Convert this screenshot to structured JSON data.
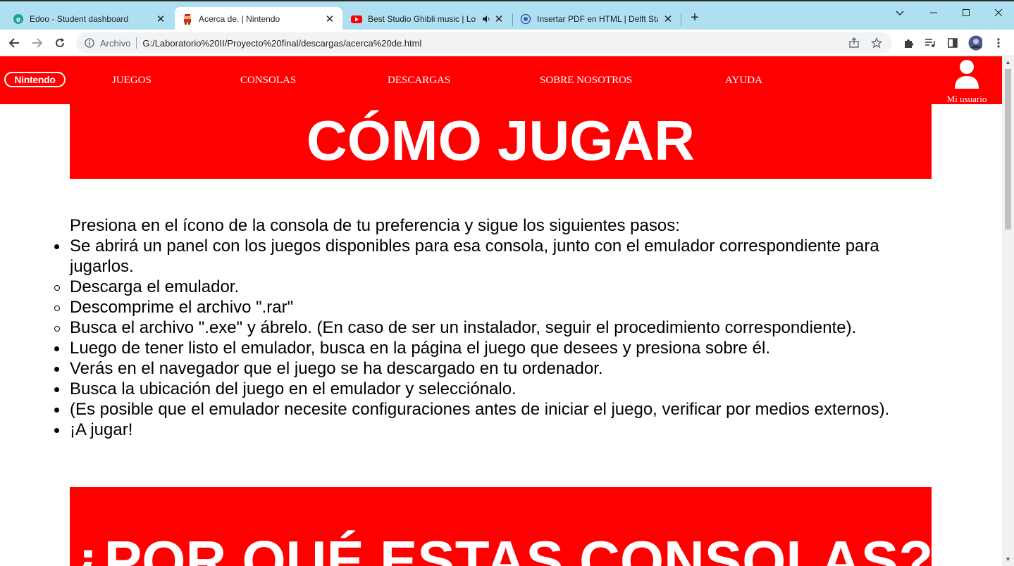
{
  "browser": {
    "tabs": [
      {
        "title": "Edoo - Student dashboard",
        "icon": "edoo-icon",
        "active": false
      },
      {
        "title": "Acerca de. | Nintendo",
        "icon": "mario-icon",
        "active": true
      },
      {
        "title": "Best Studio Ghibli music | Lo",
        "icon": "youtube-icon",
        "active": false
      },
      {
        "title": "Insertar PDF en HTML | Delft Stac",
        "icon": "delft-icon",
        "active": false
      }
    ],
    "address": {
      "label": "Archivo",
      "url": "G:/Laboratorio%20II/Proyecto%20final/descargas/acerca%20de.html"
    }
  },
  "site": {
    "logo": "Nintendo",
    "nav": [
      "JUEGOS",
      "CONSOLAS",
      "DESCARGAS",
      "SOBRE NOSOTROS",
      "AYUDA"
    ],
    "user_label": "Mi usuario",
    "brand_color": "#ff0000"
  },
  "main": {
    "banner_title": "CÓMO JUGAR",
    "intro": "Presiona en el ícono de la consola de tu preferencia y sigue los siguientes pasos:",
    "steps": [
      {
        "text": "Se abrirá un panel con los juegos disponibles para esa consola, junto con el emulador correspondiente para jugarlos.",
        "bullet": "disc"
      },
      {
        "text": "Descarga el emulador.",
        "bullet": "circle"
      },
      {
        "text": "Descomprime el archivo \".rar\"",
        "bullet": "circle"
      },
      {
        "text": "Busca el archivo \".exe\" y ábrelo. (En caso de ser un instalador, seguir el procedimiento correspondiente).",
        "bullet": "circle"
      },
      {
        "text": "Luego de tener listo el emulador, busca en la página el juego que desees y presiona sobre él.",
        "bullet": "disc"
      },
      {
        "text": "Verás en el navegador que el juego se ha descargado en tu ordenador.",
        "bullet": "disc"
      },
      {
        "text": "Busca la ubicación del juego en el emulador y selecciónalo.",
        "bullet": "disc"
      },
      {
        "text": "(Es posible que el emulador necesite configuraciones antes de iniciar el juego, verificar por medios externos).",
        "bullet": "disc"
      },
      {
        "text": "¡A jugar!",
        "bullet": "disc"
      }
    ],
    "second_banner_title": "¿POR QUÉ ESTAS CONSOLAS?"
  }
}
